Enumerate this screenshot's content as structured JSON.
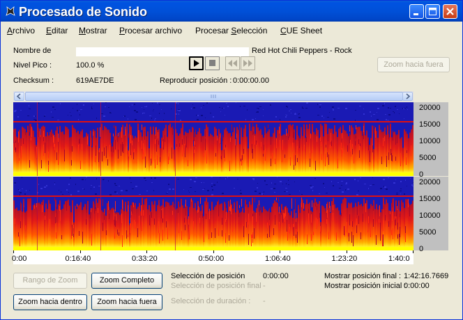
{
  "window": {
    "title": "Procesado de Sonido"
  },
  "menu": [
    {
      "pre": "",
      "u": "A",
      "post": "rchivo"
    },
    {
      "pre": "",
      "u": "E",
      "post": "ditar"
    },
    {
      "pre": "",
      "u": "M",
      "post": "ostrar"
    },
    {
      "pre": "",
      "u": "P",
      "post": "rocesar archivo"
    },
    {
      "pre": "Procesar ",
      "u": "S",
      "post": "elección"
    },
    {
      "pre": "",
      "u": "C",
      "post": "UE Sheet"
    }
  ],
  "info": {
    "name_label": "Nombre de",
    "name_value_visible": "Red Hot Chili Peppers - Rock",
    "peak_label": "Nivel Pico :",
    "peak_value": "100.0 %",
    "checksum_label": "Checksum :",
    "checksum_value": "619AE7DE",
    "play_pos_label": "Reproducir posición :",
    "play_pos_value": "0:00:00.00"
  },
  "buttons": {
    "zoom_out_top": "Zoom hacia fuera",
    "zoom_range": "Rango de Zoom",
    "zoom_full": "Zoom Completo",
    "zoom_in": "Zoom hacia dentro",
    "zoom_out": "Zoom hacia fuera"
  },
  "selection": {
    "pos_label": "Selección de posición",
    "pos_value": "0:00:00",
    "end_label": "Selección de posición final",
    "end_value": "-",
    "dur_label": "Selección de duración :",
    "dur_value": "-"
  },
  "display": {
    "final_label": "Mostrar posición final :",
    "final_value": "1:42:16.7669",
    "initial_label": "Mostrar posición inicial :",
    "initial_value": "0:00:00"
  },
  "freq_ticks": [
    "20000",
    "15000",
    "10000",
    "5000",
    "0"
  ],
  "time_ticks": [
    "0:00",
    "0:16:40",
    "0:33:20",
    "0:50:00",
    "1:06:40",
    "1:23:20",
    "1:40:0"
  ],
  "colors": {
    "title_bar": "#0050d8",
    "spectro_low": "#1a1ab4",
    "spectro_mid": "#ff0000",
    "spectro_high": "#ffff00"
  }
}
